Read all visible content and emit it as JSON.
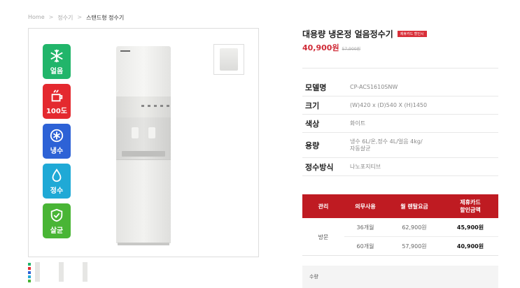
{
  "breadcrumb": [
    "Home",
    "정수기",
    "스탠드형 정수기"
  ],
  "badges": [
    {
      "label": "얼음",
      "icon": "snowflake-icon",
      "color": "#21b56a"
    },
    {
      "label": "100도",
      "icon": "kettle-icon",
      "color": "#e4292f"
    },
    {
      "label": "냉수",
      "icon": "cold-drop-icon",
      "color": "#2d62d6"
    },
    {
      "label": "정수",
      "icon": "water-drop-icon",
      "color": "#1fa9d6"
    },
    {
      "label": "살균",
      "icon": "shield-check-icon",
      "color": "#49b535"
    }
  ],
  "product": {
    "title": "대용량 냉온정 얼음정수기",
    "tag": "제휴카드 할인시",
    "price": "40,900원",
    "original_price": "57,900원"
  },
  "specs": [
    {
      "key": "모델명",
      "value": "CP-ACS1610SNW"
    },
    {
      "key": "크기",
      "value": "(W)420 x (D)540 X (H)1450"
    },
    {
      "key": "색상",
      "value": "화이트"
    },
    {
      "key": "용량",
      "value": "냉수 6L/온,정수 4L/얼음 4kg/",
      "value2": "자동살균"
    },
    {
      "key": "정수방식",
      "value": "나노포지티브"
    }
  ],
  "rental": {
    "headers": [
      "관리",
      "의무사용",
      "월 렌탈요금",
      "제휴카드",
      "할인금액"
    ],
    "care_type": "방문",
    "rows": [
      {
        "term": "36개월",
        "fee": "62,900원",
        "discount": "45,900원"
      },
      {
        "term": "60개월",
        "fee": "57,900원",
        "discount": "40,900원"
      }
    ]
  },
  "quantity_label": "수량",
  "colors": {
    "accent": "#bf1b22",
    "price": "#d02c38"
  }
}
